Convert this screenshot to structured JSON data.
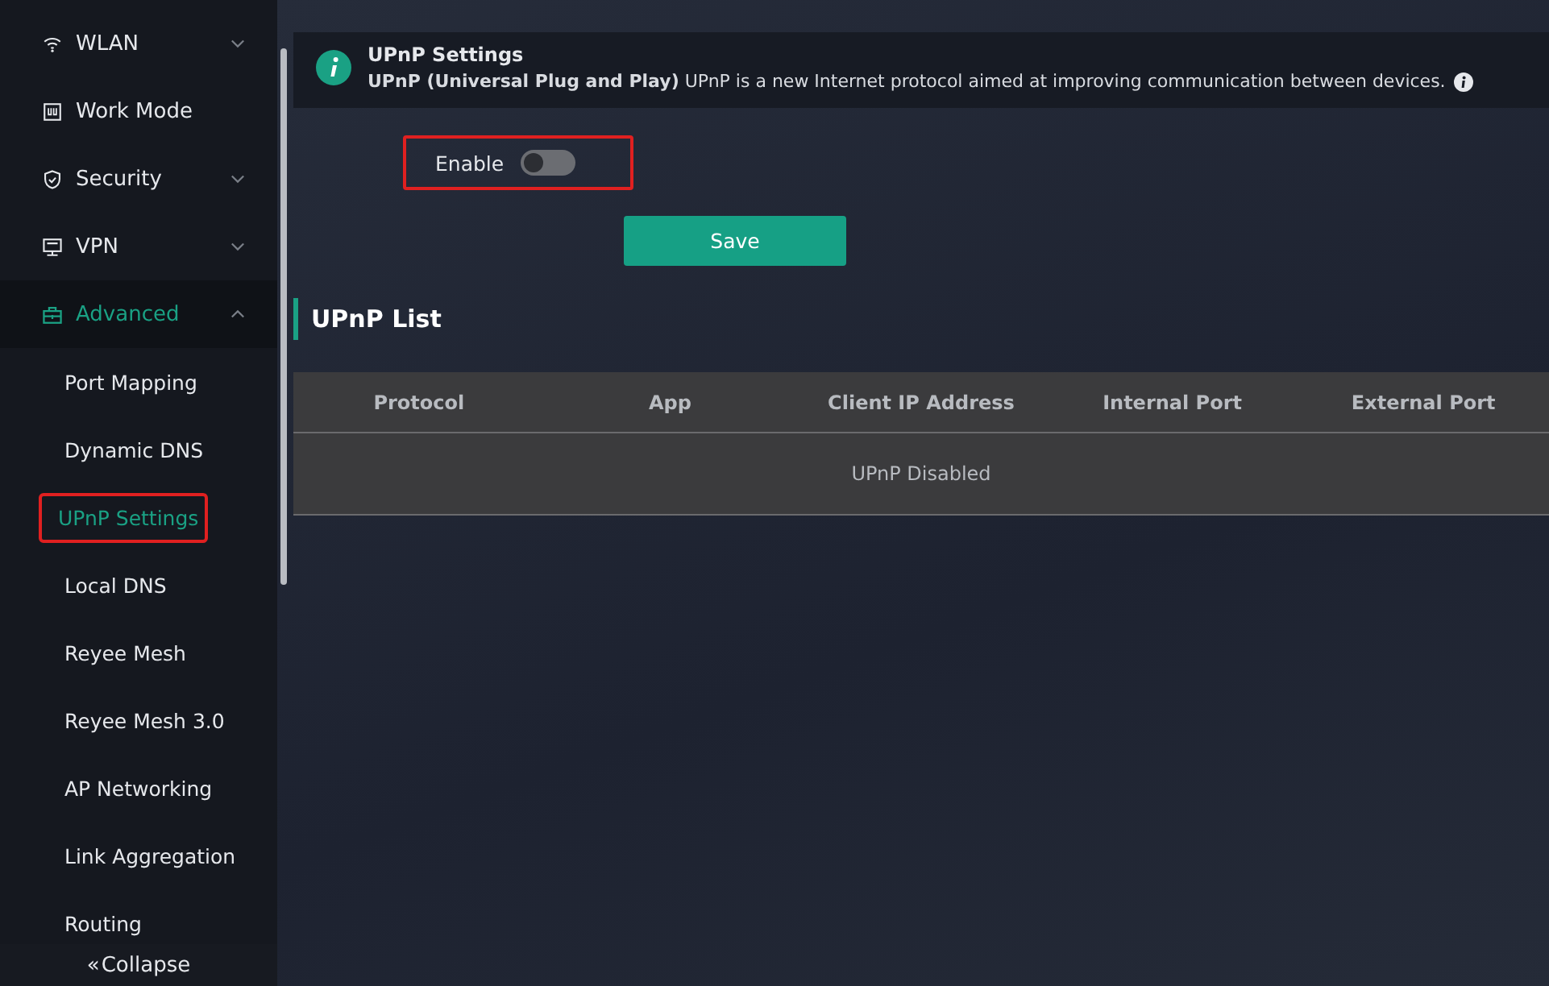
{
  "sidebar": {
    "items": [
      {
        "label": "WLAN",
        "expanded": false,
        "selected": false
      },
      {
        "label": "Work Mode",
        "selected": false
      },
      {
        "label": "Security",
        "expanded": false,
        "selected": false
      },
      {
        "label": "VPN",
        "expanded": false,
        "selected": false
      },
      {
        "label": "Advanced",
        "expanded": true,
        "selected": true,
        "children": [
          {
            "label": "Port Mapping",
            "selected": false,
            "highlighted": false
          },
          {
            "label": "Dynamic DNS",
            "selected": false,
            "highlighted": false
          },
          {
            "label": "UPnP Settings",
            "selected": true,
            "highlighted": true
          },
          {
            "label": "Local DNS",
            "selected": false,
            "highlighted": false
          },
          {
            "label": "Reyee Mesh",
            "selected": false,
            "highlighted": false
          },
          {
            "label": "Reyee Mesh 3.0",
            "selected": false,
            "highlighted": false
          },
          {
            "label": "AP Networking",
            "selected": false,
            "highlighted": false
          },
          {
            "label": "Link Aggregation",
            "selected": false,
            "highlighted": false
          },
          {
            "label": "Routing",
            "selected": false,
            "highlighted": false
          }
        ]
      }
    ],
    "collapse": {
      "icon": "«",
      "label": "Collapse"
    }
  },
  "notice": {
    "title": "UPnP Settings",
    "text": "**UPnP  (Universal Plug and Play)** UPnP is a new Internet protocol aimed at improving communication between devices."
  },
  "form": {
    "enable": {
      "label": "Enable",
      "on": false,
      "highlighted": true
    },
    "save_button": "Save"
  },
  "upnp_list": {
    "title": "UPnP List",
    "columns": [
      "Protocol",
      "App",
      "Client IP Address",
      "Internal Port",
      "External Port"
    ],
    "empty_text": "UPnP Disabled"
  }
}
